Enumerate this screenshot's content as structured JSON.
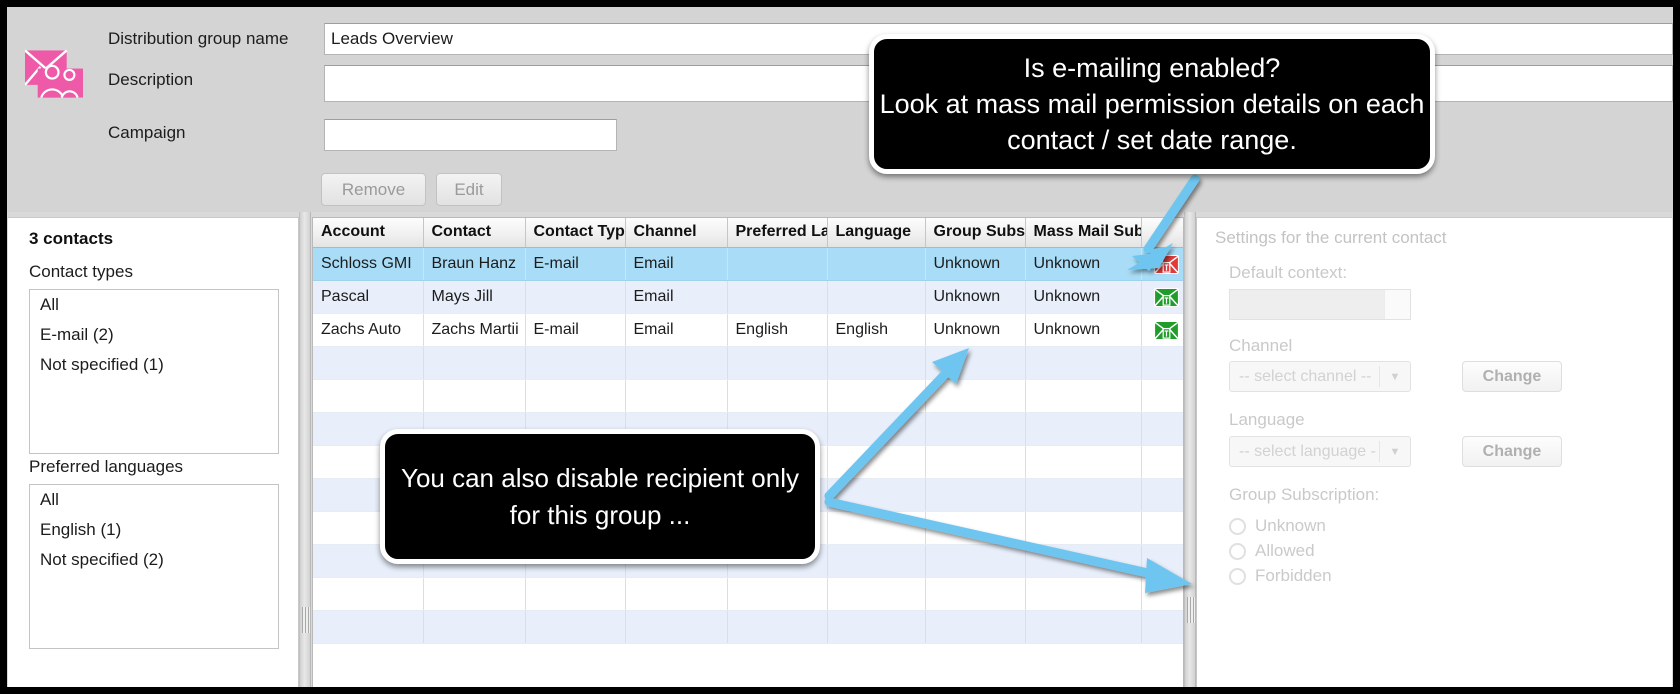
{
  "form": {
    "icon_name": "distribution-group-icon",
    "fields": [
      {
        "label": "Distribution group name",
        "value": "Leads Overview"
      },
      {
        "label": "Description",
        "value": ""
      },
      {
        "label": "Campaign",
        "value": ""
      }
    ],
    "buttons": [
      {
        "label": "Remove"
      },
      {
        "label": "Edit"
      }
    ]
  },
  "left_panel": {
    "contacts_count": "3 contacts",
    "contact_types": {
      "caption": "Contact types",
      "items": [
        "All",
        "E-mail (2)",
        "Not specified (1)"
      ]
    },
    "preferred_languages": {
      "caption": "Preferred languages",
      "items": [
        "All",
        "English (1)",
        "Not specified (2)"
      ]
    }
  },
  "table": {
    "columns": [
      "Account",
      "Contact",
      "Contact Typ",
      "Channel",
      "Preferred La",
      "Language",
      "Group Subs",
      "Mass Mail Subs",
      ""
    ],
    "rows": [
      {
        "selected": true,
        "cells": [
          "Schloss GMI",
          "Braun Hanz",
          "E-mail",
          "Email",
          "",
          "",
          "Unknown",
          "Unknown"
        ],
        "icon": "mail-forbidden-icon",
        "icon_color": "#e03a3a"
      },
      {
        "selected": false,
        "cells": [
          "Pascal",
          "Mays Jill",
          "",
          "Email",
          "",
          "",
          "Unknown",
          "Unknown"
        ],
        "icon": "mail-allowed-icon",
        "icon_color": "#1f9c2a"
      },
      {
        "selected": false,
        "cells": [
          "Zachs Auto",
          "Zachs Martii",
          "E-mail",
          "Email",
          "English",
          "English",
          "Unknown",
          "Unknown"
        ],
        "icon": "mail-allowed-icon",
        "icon_color": "#1f9c2a"
      }
    ],
    "empty_row_count": 9
  },
  "right_panel": {
    "title": "Settings for the current contact",
    "default_context_label": "Default context:",
    "default_context_value": "",
    "channel_label": "Channel",
    "channel_value": "-- select channel --",
    "channel_change": "Change",
    "language_label": "Language",
    "language_value": "-- select language -",
    "language_change": "Change",
    "group_subscription_label": "Group Subscription:",
    "group_subscription_options": [
      "Unknown",
      "Allowed",
      "Forbidden"
    ]
  },
  "annotations": {
    "callout_1_line_1": "Is e-mailing enabled?",
    "callout_1_line_2": "Look at mass mail permission details on each",
    "callout_1_line_3": "contact / set date range.",
    "callout_2_line_1": "You can also disable recipient only",
    "callout_2_line_2": "for this group ...",
    "arrow_color": "#6ec6f0"
  }
}
